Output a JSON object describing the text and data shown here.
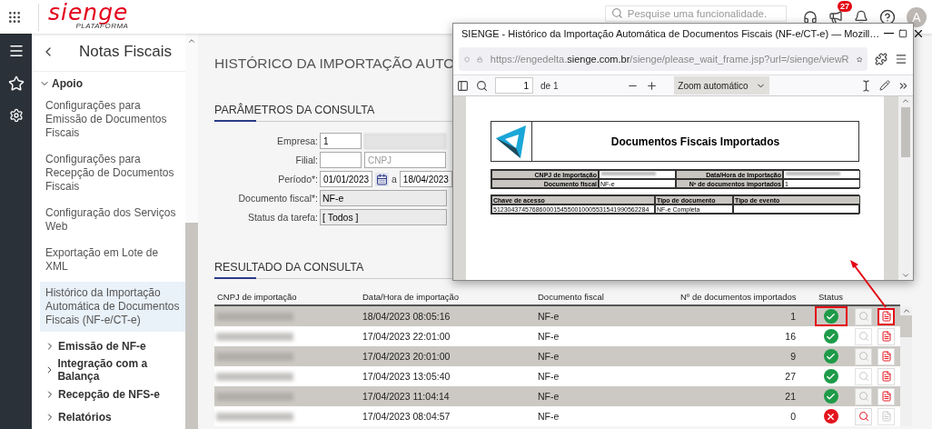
{
  "top_bar": {
    "logo": "sienge",
    "logo_subtitle": "PLATAFORMA",
    "search": {
      "placeholder": "Pesquise uma funcionalidade."
    },
    "notifications_badge": "27",
    "avatar": "A"
  },
  "sidebar": {
    "title": "Notas Fiscais",
    "section": {
      "label": "Apoio",
      "expanded": true
    },
    "items": [
      {
        "label": "Configurações para Emissão de Documentos Fiscais",
        "selected": false
      },
      {
        "label": "Configurações para Recepção de Documentos Fiscais",
        "selected": false
      },
      {
        "label": "Configuração dos Serviços Web",
        "selected": false
      },
      {
        "label": "Exportação em Lote de XML",
        "selected": false
      },
      {
        "label": "Histórico da Importação Automática de Documentos Fiscais (NF-e/CT-e)",
        "selected": true
      }
    ],
    "groups": [
      {
        "label": "Emissão de NF-e",
        "expanded": false
      },
      {
        "label": "Integração com a Balança",
        "expanded": false
      },
      {
        "label": "Recepção de NFS-e",
        "expanded": false
      },
      {
        "label": "Relatórios",
        "expanded": false
      }
    ]
  },
  "page": {
    "title": "HISTÓRICO DA IMPORTAÇÃO AUTO",
    "parameters": {
      "heading": "PARÂMETROS DA CONSULTA",
      "fields": [
        {
          "kind": "company",
          "label": "Empresa:",
          "value": "1"
        },
        {
          "kind": "branch",
          "label": "Filial:",
          "placeholder": "CNPJ"
        },
        {
          "kind": "period",
          "label": "Período*:",
          "from": "01/01/2023",
          "separator": "a",
          "to": "18/04/2023"
        },
        {
          "kind": "select",
          "label": "Documento fiscal*:",
          "value": "NF-e"
        },
        {
          "kind": "select",
          "label": "Status da tarefa:",
          "value": "[ Todos ]"
        }
      ]
    },
    "results": {
      "heading": "RESULTADO DA CONSULTA",
      "columns": [
        "CNPJ de importação",
        "Data/Hora de importação",
        "Documento fiscal",
        "Nº de documentos importados",
        "Status"
      ],
      "rows": [
        {
          "date": "18/04/2023 08:05:16",
          "document": "NF-e",
          "count": "1",
          "kind": "ok",
          "view_enabled": false,
          "pdf_enabled": true,
          "highlighted": true
        },
        {
          "date": "17/04/2023 22:01:00",
          "document": "NF-e",
          "count": "16",
          "kind": "ok",
          "view_enabled": false,
          "pdf_enabled": true,
          "highlighted": false
        },
        {
          "date": "17/04/2023 20:01:00",
          "document": "NF-e",
          "count": "9",
          "kind": "ok",
          "view_enabled": false,
          "pdf_enabled": true,
          "highlighted": false
        },
        {
          "date": "17/04/2023 13:05:40",
          "document": "NF-e",
          "count": "27",
          "kind": "ok",
          "view_enabled": false,
          "pdf_enabled": true,
          "highlighted": false
        },
        {
          "date": "17/04/2023 11:04:14",
          "document": "NF-e",
          "count": "21",
          "kind": "ok",
          "view_enabled": false,
          "pdf_enabled": true,
          "highlighted": false
        },
        {
          "date": "17/04/2023 08:04:57",
          "document": "NF-e",
          "count": "0",
          "kind": "error",
          "view_enabled": true,
          "pdf_enabled": false,
          "highlighted": false
        }
      ]
    }
  },
  "popup": {
    "title": "SIENGE -  Histórico da Importação Automática de Documentos Fiscais (NF-e/CT-e) — Mozill…",
    "url": "https://engedelta.**sienge.com.br**/sienge/please_wait_frame.jsp?url=/sienge/viewR",
    "page_input": "1",
    "page_total": "de 1",
    "zoom": "Zoom automático",
    "document": {
      "title": "Documentos Fiscais Importados",
      "info": [
        {
          "label": "CNPJ de Importação"
        },
        {
          "label": "Data/Hora de Importação"
        },
        {
          "label": "Documento fiscal",
          "value": "NF-e"
        },
        {
          "label": "Nº de documentos importados",
          "value": "1"
        }
      ],
      "columns": [
        "Chave de acesso",
        "Tipo de documento",
        "Tipo de evento"
      ],
      "rows": [
        [
          "51230437457686000154550010005531541990562284",
          "NF-e Completa"
        ]
      ]
    }
  }
}
